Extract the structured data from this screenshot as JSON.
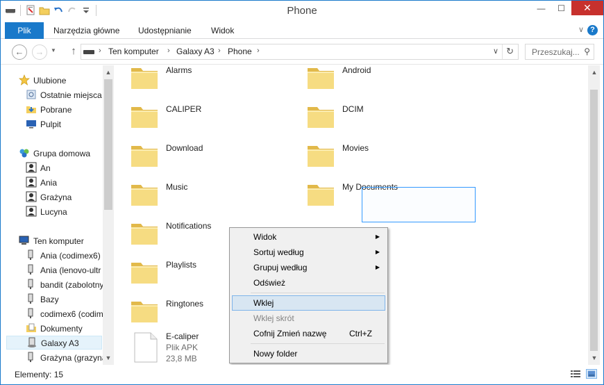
{
  "window": {
    "title": "Phone"
  },
  "ribbon": {
    "tabs": [
      "Plik",
      "Narzędzia główne",
      "Udostępnianie",
      "Widok"
    ]
  },
  "address": {
    "crumbs": [
      "Ten komputer",
      "Galaxy A3",
      "Phone"
    ],
    "search_placeholder": "Przeszukaj..."
  },
  "nav_pane": {
    "favorites": {
      "label": "Ulubione",
      "items": [
        "Ostatnie miejsca",
        "Pobrane",
        "Pulpit"
      ]
    },
    "homegroup": {
      "label": "Grupa domowa",
      "items": [
        "An",
        "Ania",
        "Grażyna",
        "Lucyna"
      ]
    },
    "computer": {
      "label": "Ten komputer",
      "items": [
        "Ania (codimex6)",
        "Ania (lenovo-ultr",
        "bandit (zabolotny",
        "Bazy",
        "codimex6 (codim",
        "Dokumenty",
        "Galaxy A3",
        "Grażyna (grazyna"
      ],
      "selected": "Galaxy A3"
    }
  },
  "content": {
    "folders_left": [
      "Alarms",
      "CALIPER",
      "Download",
      "Music",
      "Notifications",
      "Playlists",
      "Ringtones"
    ],
    "folders_right": [
      "Android",
      "DCIM",
      "Movies",
      "My Documents"
    ],
    "file": {
      "name": "E-caliper",
      "type": "Plik APK",
      "size": "23,8 MB"
    }
  },
  "context_menu": {
    "view": "Widok",
    "sort": "Sortuj według",
    "group": "Grupuj według",
    "refresh": "Odśwież",
    "paste": "Wklej",
    "paste_shortcut": "Wklej skrót",
    "undo": "Cofnij Zmień nazwę",
    "undo_shortcut": "Ctrl+Z",
    "new_folder": "Nowy folder"
  },
  "status": {
    "items": "Elementy: 15"
  },
  "colors": {
    "accent": "#1979ca",
    "close": "#c7312d",
    "folder": "#f0d47c"
  }
}
